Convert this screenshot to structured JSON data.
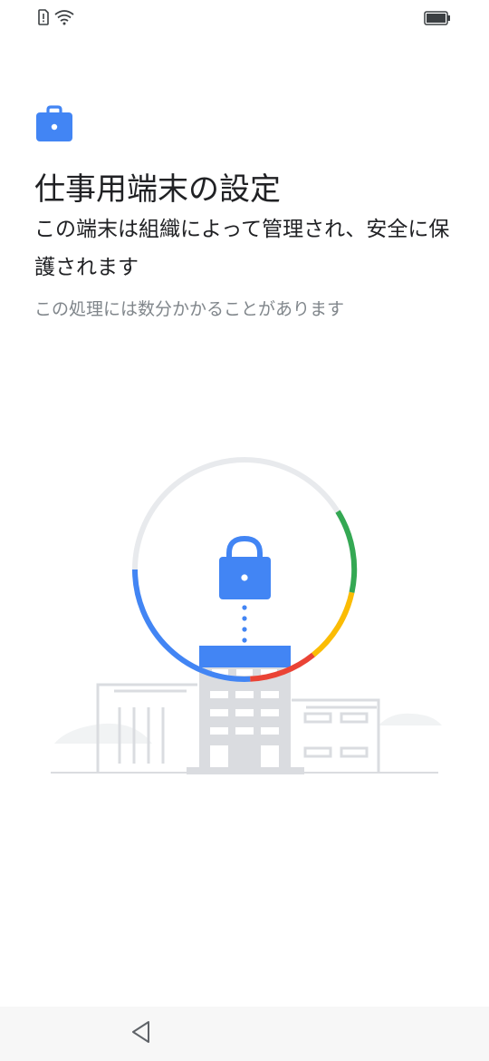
{
  "status_bar": {
    "left_icons": [
      "sim-alert-icon",
      "wifi-icon"
    ],
    "right_icons": [
      "battery-icon"
    ]
  },
  "header": {
    "icon": "briefcase-icon",
    "title": "仕事用端末の設定",
    "subtitle": "この端末は組織によって管理され、安全に保護されます",
    "note": "この処理には数分かかることがあります"
  },
  "illustration": {
    "icons": [
      "padlock-icon",
      "office-building-icon"
    ],
    "colors": {
      "blue": "#4285f4",
      "red": "#ea4335",
      "yellow": "#fbbc04",
      "green": "#34a853",
      "ring_gray": "#e8eaed",
      "building_gray": "#dadce0"
    }
  },
  "nav_bar": {
    "back_icon": "back-triangle-icon"
  }
}
